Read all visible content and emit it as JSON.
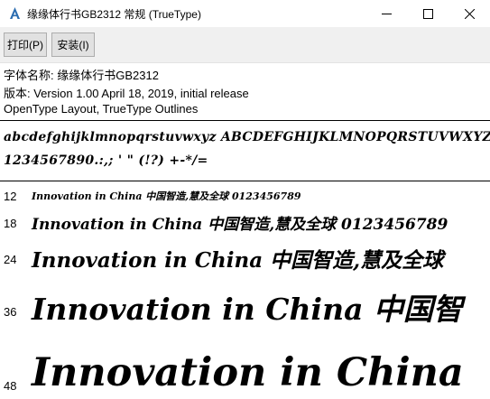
{
  "window": {
    "title": "缘缘体行书GB2312 常规 (TrueType)",
    "icon": "font-file-icon"
  },
  "toolbar": {
    "print_label": "打印(P)",
    "install_label": "安装(I)"
  },
  "info": {
    "font_name": "字体名称: 缘缘体行书GB2312",
    "version": "版本: Version 1.00 April 18, 2019, initial release",
    "outlines": "OpenType Layout, TrueType Outlines"
  },
  "charset": {
    "line1": "abcdefghijklmnopqrstuvwxyz ABCDEFGHIJKLMNOPQRSTUVWXYZ",
    "line2": "1234567890.:,; ' \" (!?) +-*/="
  },
  "samples": [
    {
      "size": "12",
      "text": "Innovation in China 中国智造,慧及全球 0123456789"
    },
    {
      "size": "18",
      "text": "Innovation in China 中国智造,慧及全球 0123456789"
    },
    {
      "size": "24",
      "text": "Innovation in China 中国智造,慧及全球"
    },
    {
      "size": "36",
      "text": "Innovation in China 中国智"
    },
    {
      "size": "48",
      "text": "Innovation in China"
    }
  ]
}
